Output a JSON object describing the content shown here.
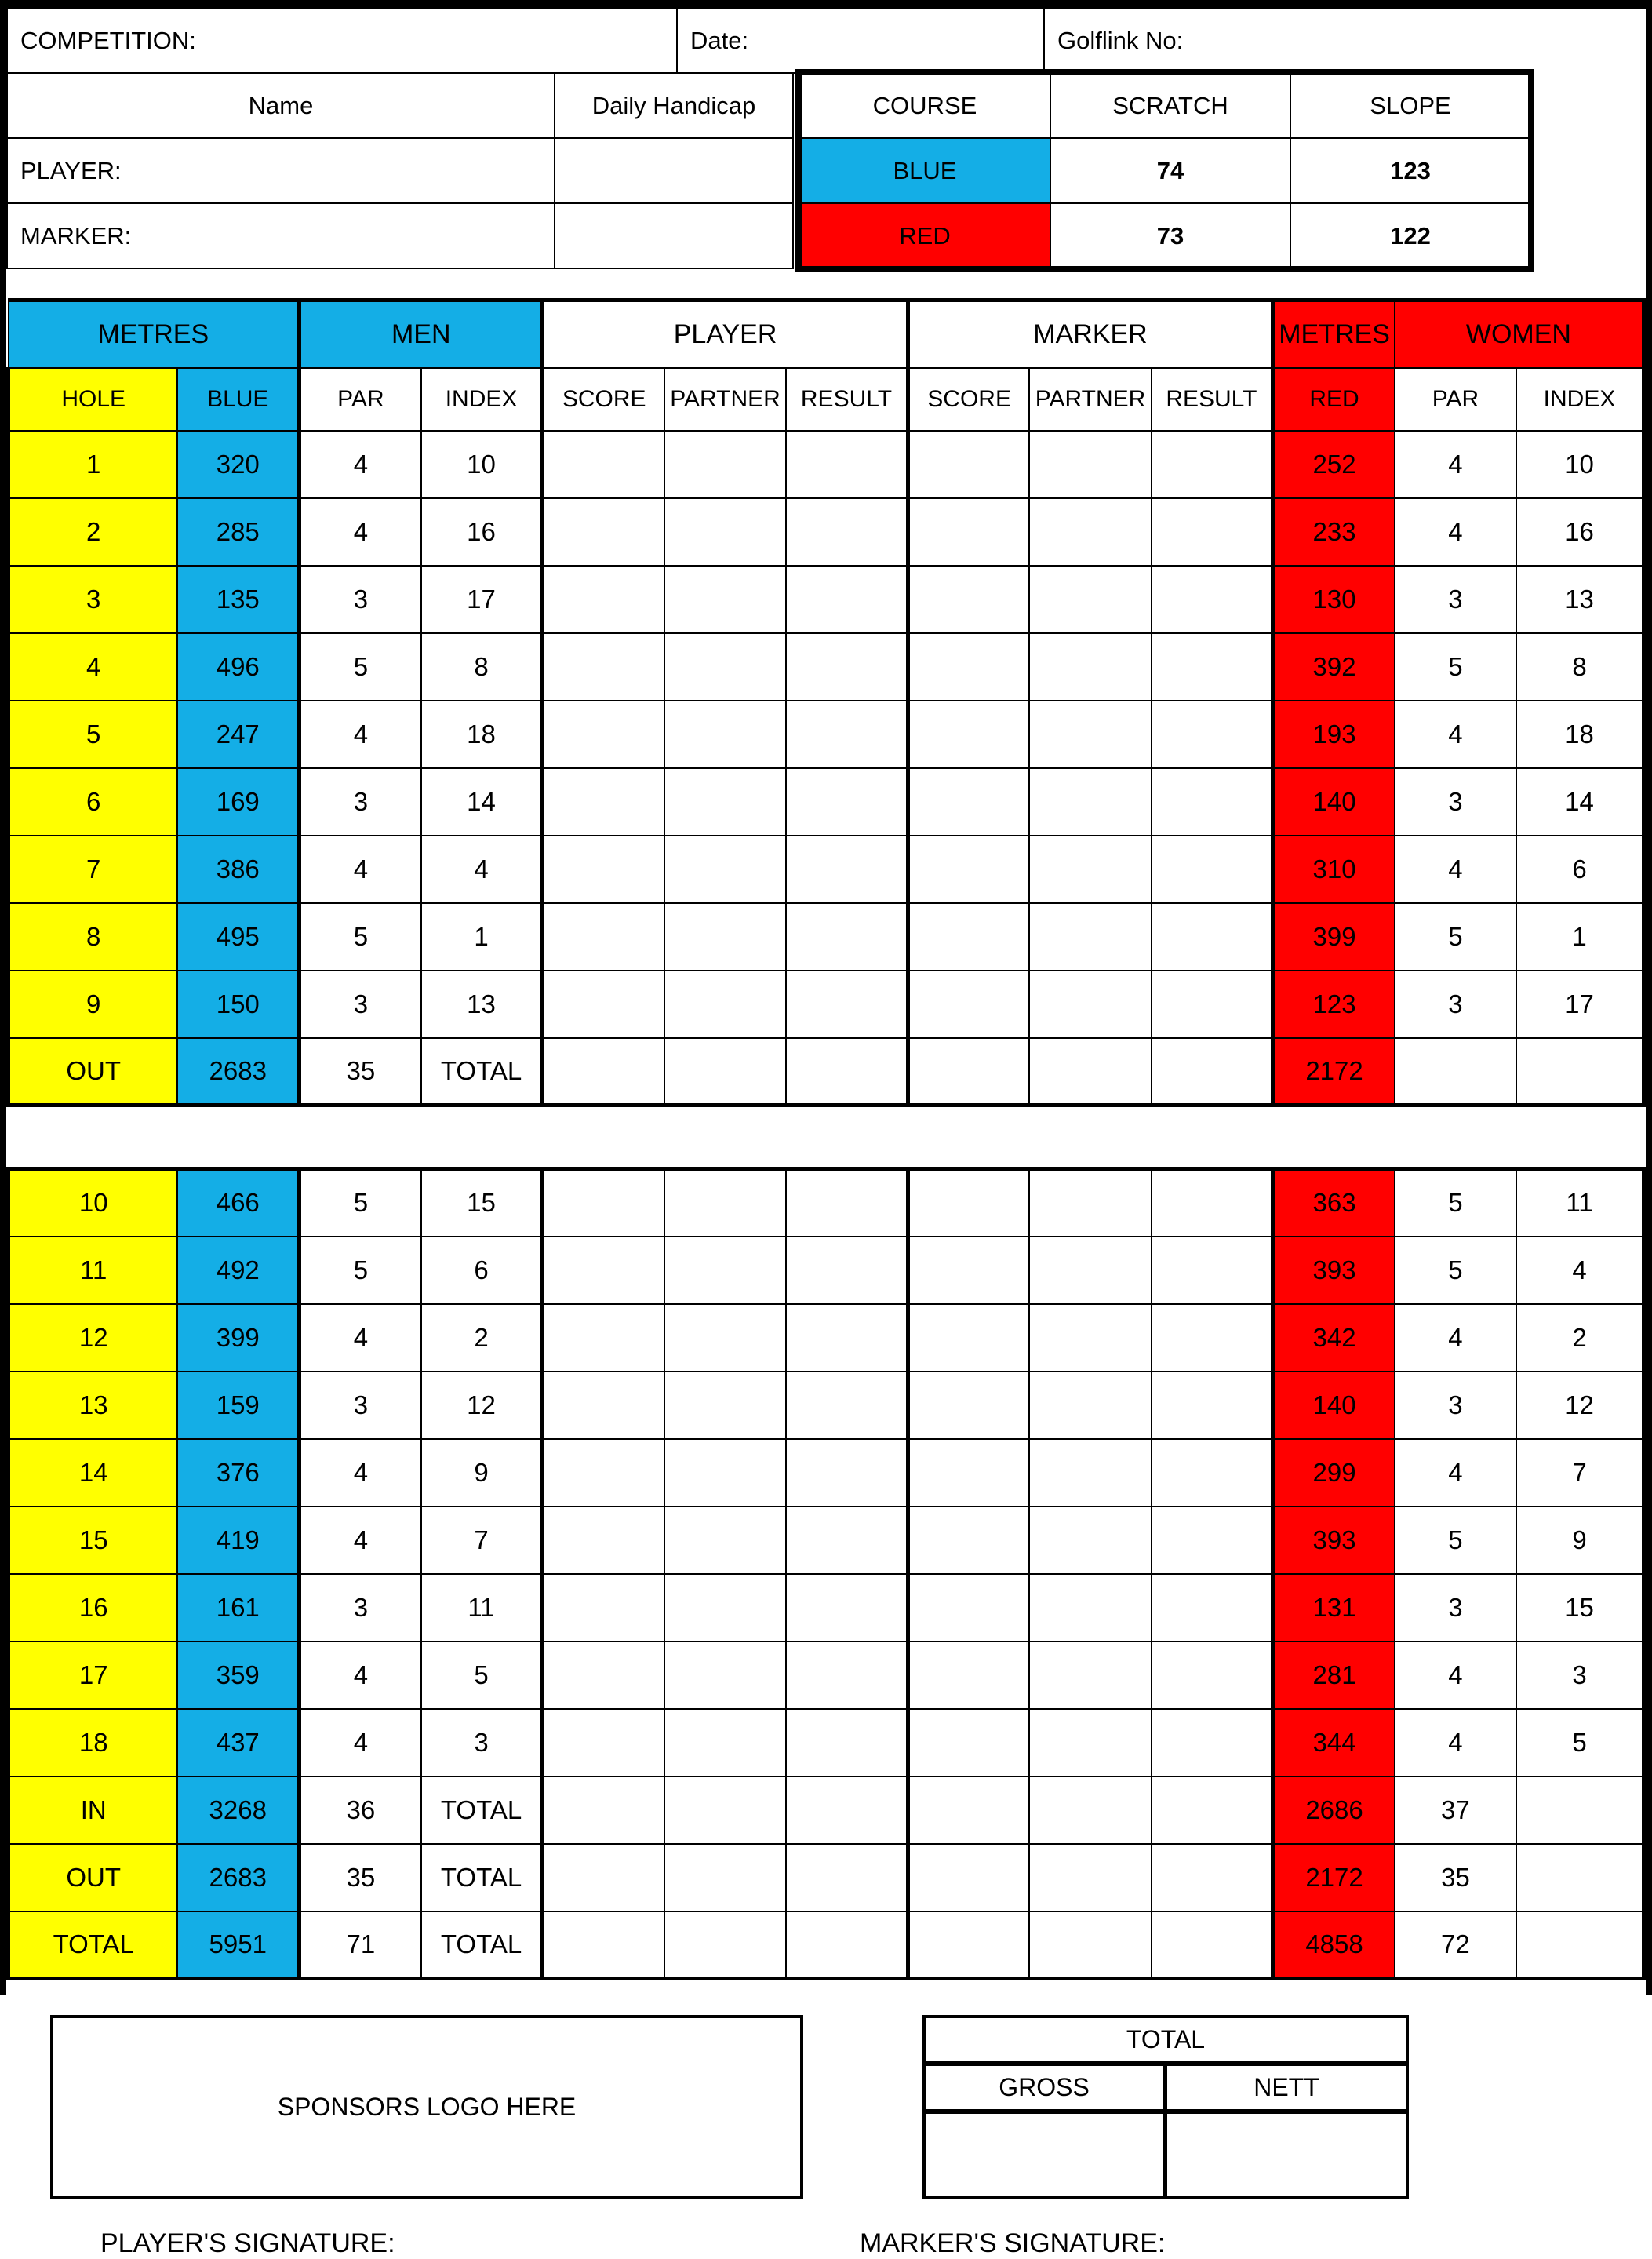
{
  "header": {
    "competition_label": "COMPETITION:",
    "date_label": "Date:",
    "golflink_label": "Golflink No:",
    "name_label": "Name",
    "daily_handicap_label": "Daily Handicap",
    "player_label": "PLAYER:",
    "marker_label": "MARKER:",
    "rating_table": {
      "columns": [
        "COURSE",
        "SCRATCH",
        "SLOPE"
      ],
      "rows": [
        {
          "course": "BLUE",
          "scratch": "74",
          "slope": "123",
          "color": "#14AEE6"
        },
        {
          "course": "RED",
          "scratch": "73",
          "slope": "122",
          "color": "#FF0000"
        }
      ]
    }
  },
  "colors": {
    "blue": "#14AEE6",
    "red": "#FF0000",
    "yellow": "#FFFF00",
    "black": "#000000",
    "white": "#FFFFFF"
  },
  "scorecard": {
    "group_headers": [
      {
        "label": "METRES",
        "bg": "#14AEE6"
      },
      {
        "label": "MEN",
        "bg": "#14AEE6"
      },
      {
        "label": "PLAYER",
        "bg": "#FFFFFF"
      },
      {
        "label": "MARKER",
        "bg": "#FFFFFF"
      },
      {
        "label": "METRES",
        "bg": "#FF0000"
      },
      {
        "label": "WOMEN",
        "bg": "#FF0000"
      }
    ],
    "columns": [
      {
        "label": "HOLE",
        "bg": "#FFFF00"
      },
      {
        "label": "BLUE",
        "bg": "#14AEE6"
      },
      {
        "label": "PAR",
        "bg": "#FFFFFF"
      },
      {
        "label": "INDEX",
        "bg": "#FFFFFF"
      },
      {
        "label": "SCORE",
        "bg": "#FFFFFF"
      },
      {
        "label": "PARTNER",
        "bg": "#FFFFFF"
      },
      {
        "label": "RESULT",
        "bg": "#FFFFFF"
      },
      {
        "label": "SCORE",
        "bg": "#FFFFFF"
      },
      {
        "label": "PARTNER",
        "bg": "#FFFFFF"
      },
      {
        "label": "RESULT",
        "bg": "#FFFFFF"
      },
      {
        "label": "RED",
        "bg": "#FF0000"
      },
      {
        "label": "PAR",
        "bg": "#FFFFFF"
      },
      {
        "label": "INDEX",
        "bg": "#FFFFFF"
      }
    ],
    "front_nine": [
      {
        "hole": "1",
        "blue": "320",
        "men_par": "4",
        "men_index": "10",
        "red": "252",
        "women_par": "4",
        "women_index": "10"
      },
      {
        "hole": "2",
        "blue": "285",
        "men_par": "4",
        "men_index": "16",
        "red": "233",
        "women_par": "4",
        "women_index": "16"
      },
      {
        "hole": "3",
        "blue": "135",
        "men_par": "3",
        "men_index": "17",
        "red": "130",
        "women_par": "3",
        "women_index": "13"
      },
      {
        "hole": "4",
        "blue": "496",
        "men_par": "5",
        "men_index": "8",
        "red": "392",
        "women_par": "5",
        "women_index": "8"
      },
      {
        "hole": "5",
        "blue": "247",
        "men_par": "4",
        "men_index": "18",
        "red": "193",
        "women_par": "4",
        "women_index": "18"
      },
      {
        "hole": "6",
        "blue": "169",
        "men_par": "3",
        "men_index": "14",
        "red": "140",
        "women_par": "3",
        "women_index": "14"
      },
      {
        "hole": "7",
        "blue": "386",
        "men_par": "4",
        "men_index": "4",
        "red": "310",
        "women_par": "4",
        "women_index": "6"
      },
      {
        "hole": "8",
        "blue": "495",
        "men_par": "5",
        "men_index": "1",
        "red": "399",
        "women_par": "5",
        "women_index": "1"
      },
      {
        "hole": "9",
        "blue": "150",
        "men_par": "3",
        "men_index": "13",
        "red": "123",
        "women_par": "3",
        "women_index": "17"
      }
    ],
    "front_nine_total": {
      "label": "OUT",
      "blue": "2683",
      "men_par": "35",
      "index_label": "TOTAL",
      "red": "2172",
      "women_par": "",
      "women_index": ""
    },
    "back_nine": [
      {
        "hole": "10",
        "blue": "466",
        "men_par": "5",
        "men_index": "15",
        "red": "363",
        "women_par": "5",
        "women_index": "11"
      },
      {
        "hole": "11",
        "blue": "492",
        "men_par": "5",
        "men_index": "6",
        "red": "393",
        "women_par": "5",
        "women_index": "4"
      },
      {
        "hole": "12",
        "blue": "399",
        "men_par": "4",
        "men_index": "2",
        "red": "342",
        "women_par": "4",
        "women_index": "2"
      },
      {
        "hole": "13",
        "blue": "159",
        "men_par": "3",
        "men_index": "12",
        "red": "140",
        "women_par": "3",
        "women_index": "12"
      },
      {
        "hole": "14",
        "blue": "376",
        "men_par": "4",
        "men_index": "9",
        "red": "299",
        "women_par": "4",
        "women_index": "7"
      },
      {
        "hole": "15",
        "blue": "419",
        "men_par": "4",
        "men_index": "7",
        "red": "393",
        "women_par": "5",
        "women_index": "9"
      },
      {
        "hole": "16",
        "blue": "161",
        "men_par": "3",
        "men_index": "11",
        "red": "131",
        "women_par": "3",
        "women_index": "15"
      },
      {
        "hole": "17",
        "blue": "359",
        "men_par": "4",
        "men_index": "5",
        "red": "281",
        "women_par": "4",
        "women_index": "3"
      },
      {
        "hole": "18",
        "blue": "437",
        "men_par": "4",
        "men_index": "3",
        "red": "344",
        "women_par": "4",
        "women_index": "5"
      }
    ],
    "summary_rows": [
      {
        "label": "IN",
        "blue": "3268",
        "men_par": "36",
        "index_label": "TOTAL",
        "red": "2686",
        "women_par": "37"
      },
      {
        "label": "OUT",
        "blue": "2683",
        "men_par": "35",
        "index_label": "TOTAL",
        "red": "2172",
        "women_par": "35"
      },
      {
        "label": "TOTAL",
        "blue": "5951",
        "men_par": "71",
        "index_label": "TOTAL",
        "red": "4858",
        "women_par": "72"
      }
    ]
  },
  "footer": {
    "sponsors_text": "SPONSORS LOGO HERE",
    "total_label": "TOTAL",
    "gross_label": "GROSS",
    "nett_label": "NETT",
    "gross_value": "",
    "nett_value": "",
    "player_signature_label": "PLAYER'S SIGNATURE:",
    "marker_signature_label": "MARKER'S SIGNATURE:"
  }
}
